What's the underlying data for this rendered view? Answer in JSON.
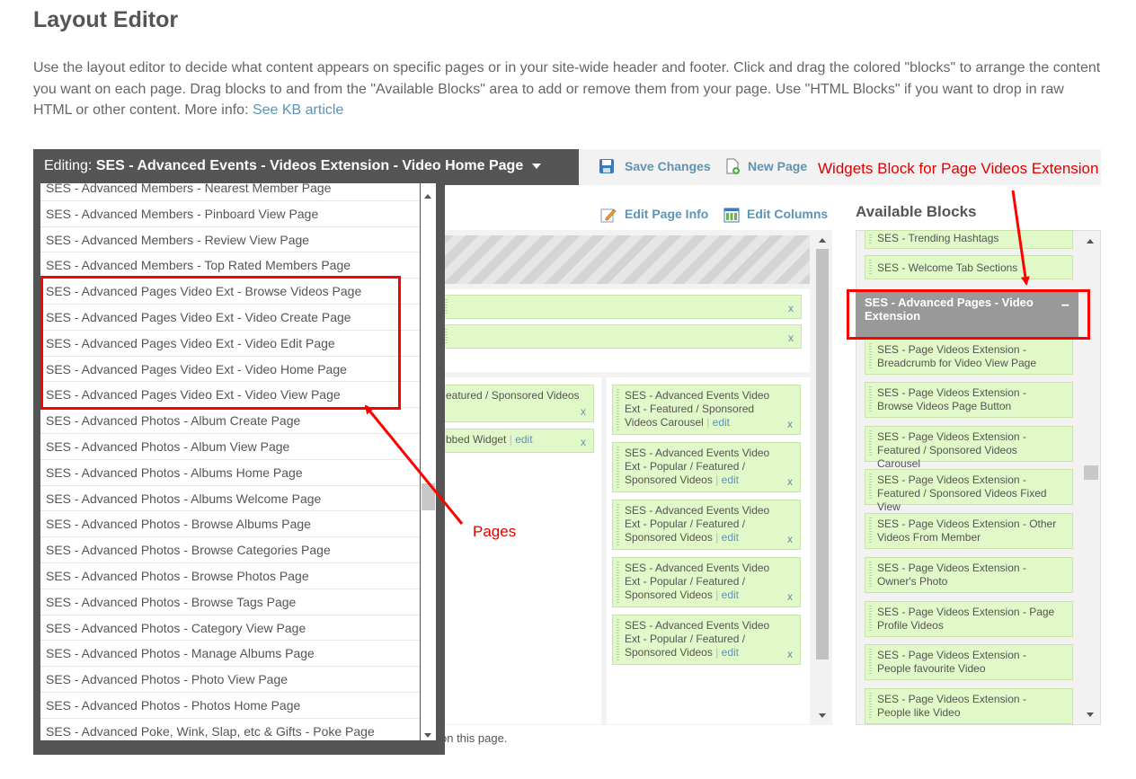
{
  "page": {
    "title": "Layout Editor",
    "description": "Use the layout editor to decide what content appears on specific pages or in your site-wide header and footer. Click and drag the colored \"blocks\" to arrange the content you want on each page. Drag blocks to and from the \"Available Blocks\" area to add or remove them from your page. Use \"HTML Blocks\" if you want to drop in raw HTML or other content. More info: ",
    "kb_link": "See KB article"
  },
  "toolbar": {
    "editing_label": "Editing:",
    "editing_value": "SES - Advanced Events - Videos Extension - Video Home Page",
    "save_changes": "Save Changes",
    "new_page": "New Page",
    "edit_page_info": "Edit Page Info",
    "edit_columns": "Edit Columns"
  },
  "dropdown": {
    "items": [
      "SES - Advanced Members - Nearest Member Page",
      "SES - Advanced Members - Pinboard View Page",
      "SES - Advanced Members - Review View Page",
      "SES - Advanced Members - Top Rated Members Page",
      "SES - Advanced Pages Video Ext - Browse Videos Page",
      "SES - Advanced Pages Video Ext - Video Create Page",
      "SES - Advanced Pages Video Ext - Video Edit Page",
      "SES - Advanced Pages Video Ext - Video Home Page",
      "SES - Advanced Pages Video Ext - Video View Page",
      "SES - Advanced Photos - Album Create Page",
      "SES - Advanced Photos - Album View Page",
      "SES - Advanced Photos - Albums Home Page",
      "SES - Advanced Photos - Albums Welcome Page",
      "SES - Advanced Photos - Browse Albums Page",
      "SES - Advanced Photos - Browse Categories Page",
      "SES - Advanced Photos - Browse Photos Page",
      "SES - Advanced Photos - Browse Tags Page",
      "SES - Advanced Photos - Category View Page",
      "SES - Advanced Photos - Manage Albums Page",
      "SES - Advanced Photos - Photo View Page",
      "SES - Advanced Photos - Photos Home Page",
      "SES - Advanced Poke, Wink, Slap, etc & Gifts - Poke Page"
    ]
  },
  "editor": {
    "middle_blocks": [
      {
        "text": "eatured / Sponsored Videos",
        "x": "x"
      },
      {
        "text": "bbed Widget",
        "edit": "edit",
        "x": "x"
      }
    ],
    "right_blocks": [
      {
        "text": "SES - Advanced Events Video Ext - Featured / Sponsored Videos Carousel",
        "edit": "edit",
        "x": "x"
      },
      {
        "text": "SES - Advanced Events Video Ext - Popular / Featured / Sponsored Videos",
        "edit": "edit",
        "x": "x"
      },
      {
        "text": "SES - Advanced Events Video Ext - Popular / Featured / Sponsored Videos",
        "edit": "edit",
        "x": "x"
      },
      {
        "text": "SES - Advanced Events Video Ext - Popular / Featured / Sponsored Videos",
        "edit": "edit",
        "x": "x"
      },
      {
        "text": "SES - Advanced Events Video Ext - Popular / Featured / Sponsored Videos",
        "edit": "edit",
        "x": "x"
      }
    ],
    "top_x": [
      "x",
      "x"
    ],
    "footnote": "on this page."
  },
  "available": {
    "title": "Available Blocks",
    "top_items": [
      "SES - Trending Hashtags",
      "SES - Welcome Tab Sections"
    ],
    "group_header": "SES - Advanced Pages - Video Extension",
    "group_toggle": "−",
    "items": [
      "SES - Page Videos Extension - Breadcrumb for Video View Page",
      "SES - Page Videos Extension - Browse Videos Page Button",
      "SES - Page Videos Extension - Featured / Sponsored Videos Carousel",
      "SES - Page Videos Extension - Featured / Sponsored Videos Fixed View",
      "SES - Page Videos Extension - Other Videos From Member",
      "SES - Page Videos Extension - Owner's Photo",
      "SES - Page Videos Extension - Page Profile Videos",
      "SES - Page Videos Extension - People favourite Video",
      "SES - Page Videos Extension - People like Video"
    ]
  },
  "annotations": {
    "widgets_label": "Widgets Block for Page Videos Extension",
    "pages_label": "Pages"
  },
  "colors": {
    "accent_link": "#5f93b4",
    "block_green": "#e1f8c8",
    "annotation_red": "#ff0000",
    "dark_tab": "#555555"
  }
}
